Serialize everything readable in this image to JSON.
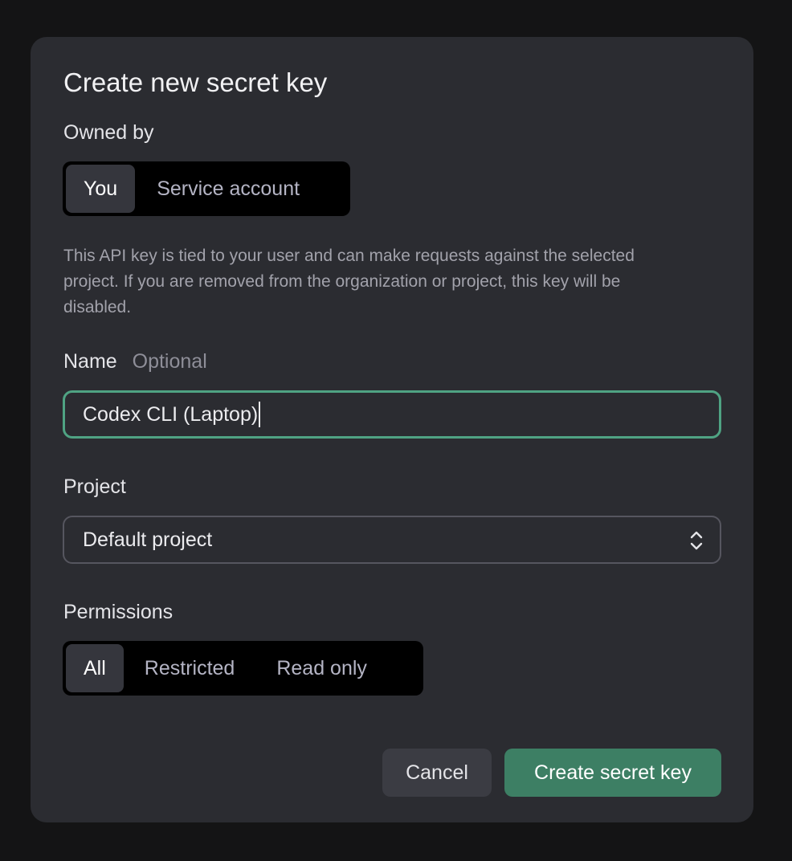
{
  "dialog": {
    "title": "Create new secret key",
    "owned_by": {
      "label": "Owned by",
      "options": [
        "You",
        "Service account"
      ],
      "selected": "You"
    },
    "description": "This API key is tied to your user and can make requests against the selected project. If you are removed from the organization or project, this key will be disabled.",
    "name": {
      "label": "Name",
      "hint": "Optional",
      "value": "Codex CLI (Laptop)"
    },
    "project": {
      "label": "Project",
      "value": "Default project",
      "icon": "chevron-up-down-icon"
    },
    "permissions": {
      "label": "Permissions",
      "options": [
        "All",
        "Restricted",
        "Read only"
      ],
      "selected": "All"
    },
    "buttons": {
      "cancel": "Cancel",
      "create": "Create secret key"
    },
    "colors": {
      "accent": "#4fa383",
      "primary_button": "#3d7f64",
      "dialog_bg": "#2b2c31"
    }
  }
}
